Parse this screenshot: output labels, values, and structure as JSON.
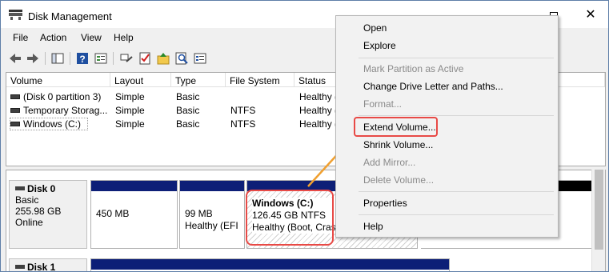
{
  "window": {
    "title": "Disk Management"
  },
  "menu": [
    "File",
    "Action",
    "View",
    "Help"
  ],
  "columns": [
    "Volume",
    "Layout",
    "Type",
    "File System",
    "Status"
  ],
  "volumes": [
    {
      "name": "(Disk 0 partition 3)",
      "layout": "Simple",
      "type": "Basic",
      "fs": "",
      "status": "Healthy ("
    },
    {
      "name": "Temporary Storag...",
      "layout": "Simple",
      "type": "Basic",
      "fs": "NTFS",
      "status": "Healthy ("
    },
    {
      "name": "Windows (C:)",
      "layout": "Simple",
      "type": "Basic",
      "fs": "NTFS",
      "status": "Healthy ("
    }
  ],
  "disks": [
    {
      "name": "Disk 0",
      "type": "Basic",
      "size": "255.98 GB",
      "state": "Online",
      "partitions": [
        {
          "line1": "450 MB",
          "line2": ""
        },
        {
          "line1": "99 MB",
          "line2": "Healthy (EFI"
        },
        {
          "title": "Windows  (C:)",
          "line1": "126.45 GB NTFS",
          "line2": "Healthy (Boot, Cras"
        }
      ]
    },
    {
      "name": "Disk 1"
    }
  ],
  "context_menu": [
    {
      "label": "Open",
      "enabled": true
    },
    {
      "label": "Explore",
      "enabled": true
    },
    {
      "label": "Mark Partition as Active",
      "enabled": false
    },
    {
      "label": "Change Drive Letter and Paths...",
      "enabled": true
    },
    {
      "label": "Format...",
      "enabled": false
    },
    {
      "label": "Extend Volume...",
      "enabled": true,
      "highlighted": true
    },
    {
      "label": "Shrink Volume...",
      "enabled": true
    },
    {
      "label": "Add Mirror...",
      "enabled": false
    },
    {
      "label": "Delete Volume...",
      "enabled": false
    },
    {
      "label": "Properties",
      "enabled": true
    },
    {
      "label": "Help",
      "enabled": true
    }
  ],
  "colors": {
    "partition_bar": "#0d1f77",
    "annotation": "#e84a46",
    "arrow": "#f0a030"
  },
  "toolbar_icons": [
    "back-arrow-icon",
    "forward-arrow-icon",
    "console-tree-icon",
    "help-icon",
    "properties-icon",
    "connect-icon",
    "checklist-icon",
    "folder-up-icon",
    "search-icon",
    "list-view-icon"
  ]
}
